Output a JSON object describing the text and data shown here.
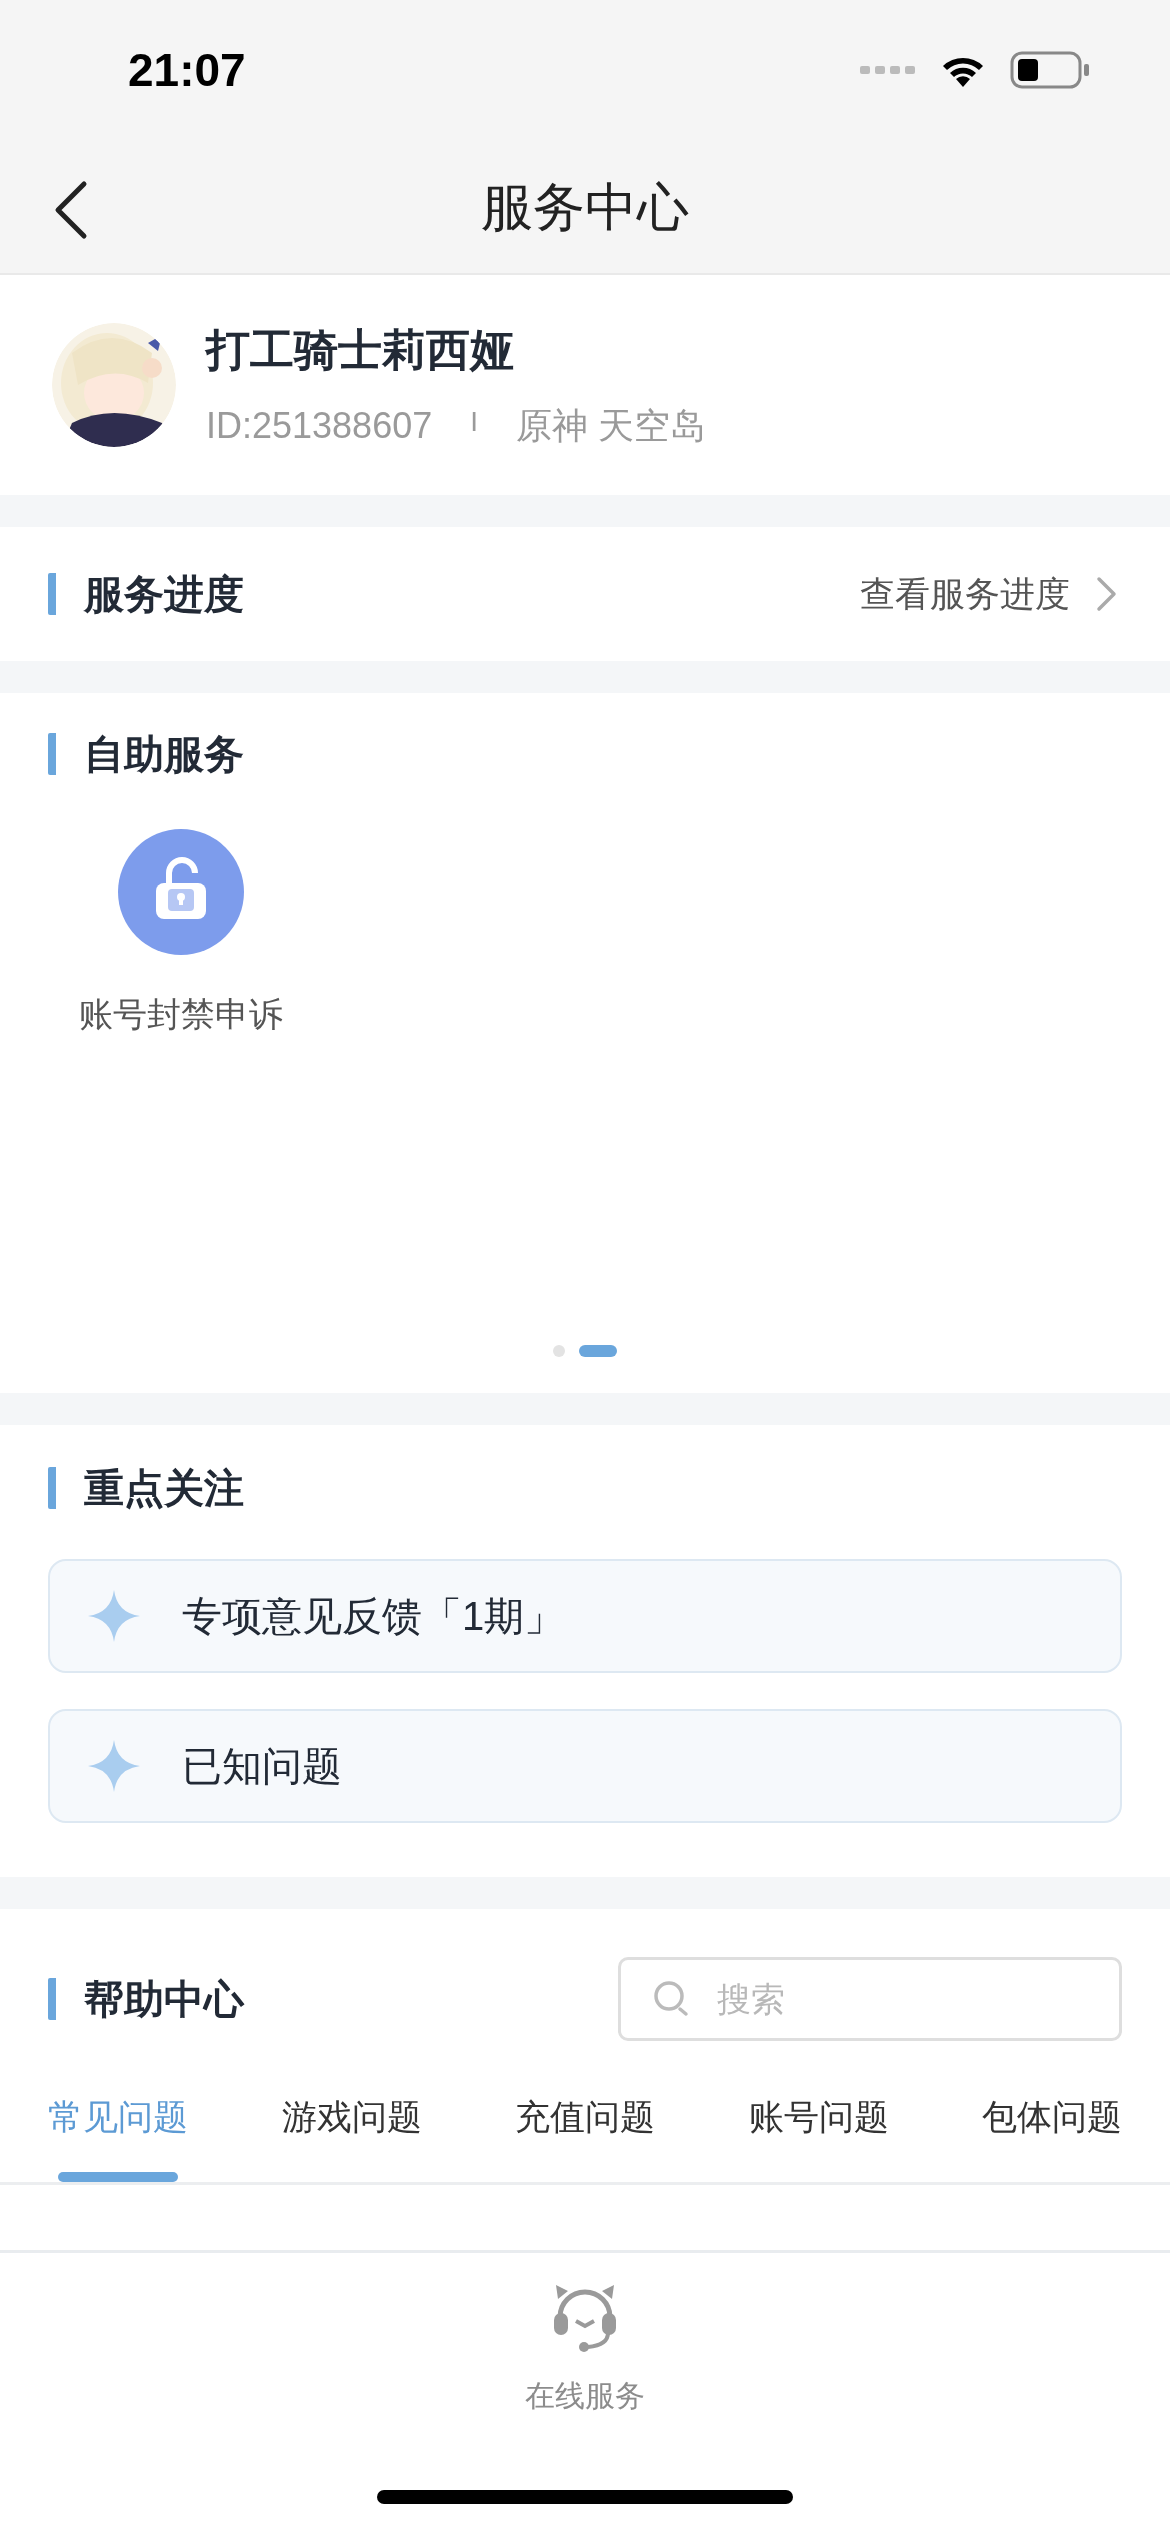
{
  "status_bar": {
    "time": "21:07"
  },
  "nav": {
    "title": "服务中心"
  },
  "profile": {
    "name": "打工骑士莉西娅",
    "id": "ID:251388607",
    "separator": "I",
    "server": "原神 天空岛"
  },
  "progress": {
    "heading": "服务进度",
    "link": "查看服务进度"
  },
  "self_service": {
    "heading": "自助服务",
    "items": [
      {
        "label": "账号封禁申诉"
      }
    ],
    "pages": [
      {
        "selected": false
      },
      {
        "selected": true
      }
    ]
  },
  "focus": {
    "heading": "重点关注",
    "items": [
      {
        "label": "专项意见反馈「1期」"
      },
      {
        "label": "已知问题"
      }
    ]
  },
  "help": {
    "heading": "帮助中心",
    "search": {
      "placeholder": "搜索"
    },
    "tabs": [
      {
        "label": "常见问题",
        "selected": true
      },
      {
        "label": "游戏问题",
        "selected": false
      },
      {
        "label": "充值问题",
        "selected": false
      },
      {
        "label": "账号问题",
        "selected": false
      },
      {
        "label": "包体问题",
        "selected": false
      }
    ]
  },
  "bottom_bar": {
    "items": [
      {
        "label": "在线服务"
      }
    ]
  }
}
